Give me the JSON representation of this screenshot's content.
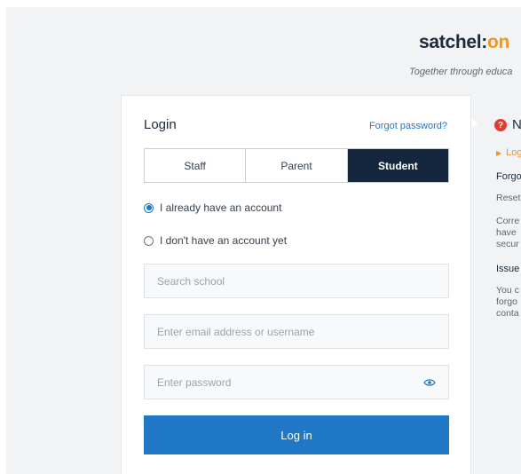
{
  "brand": {
    "name_main": "satchel:",
    "name_accent": "on",
    "tagline": "Together through educa"
  },
  "login": {
    "heading": "Login",
    "forgot_password": "Forgot password?",
    "roles": [
      "Staff",
      "Parent",
      "Student"
    ],
    "active_role": "Student",
    "account_options": [
      {
        "label": "I already have an account",
        "checked": true
      },
      {
        "label": "I don't have an account yet",
        "checked": false
      }
    ],
    "fields": {
      "school_placeholder": "Search school",
      "email_placeholder": "Enter email address or username",
      "password_placeholder": "Enter password"
    },
    "submit_label": "Log in"
  },
  "help": {
    "title": "N",
    "link": "Log",
    "section1_heading": "Forgo",
    "section1_lines": [
      "Reset",
      "Corre",
      "have",
      "secur"
    ],
    "section2_heading": "Issue",
    "section2_lines": [
      "You c",
      "forgo",
      "conta"
    ]
  },
  "colors": {
    "brand_dark": "#1d2a3b",
    "accent_orange": "#f7941d",
    "primary_blue": "#1f77c5",
    "tab_active": "#15273f",
    "help_red": "#e03c31"
  }
}
